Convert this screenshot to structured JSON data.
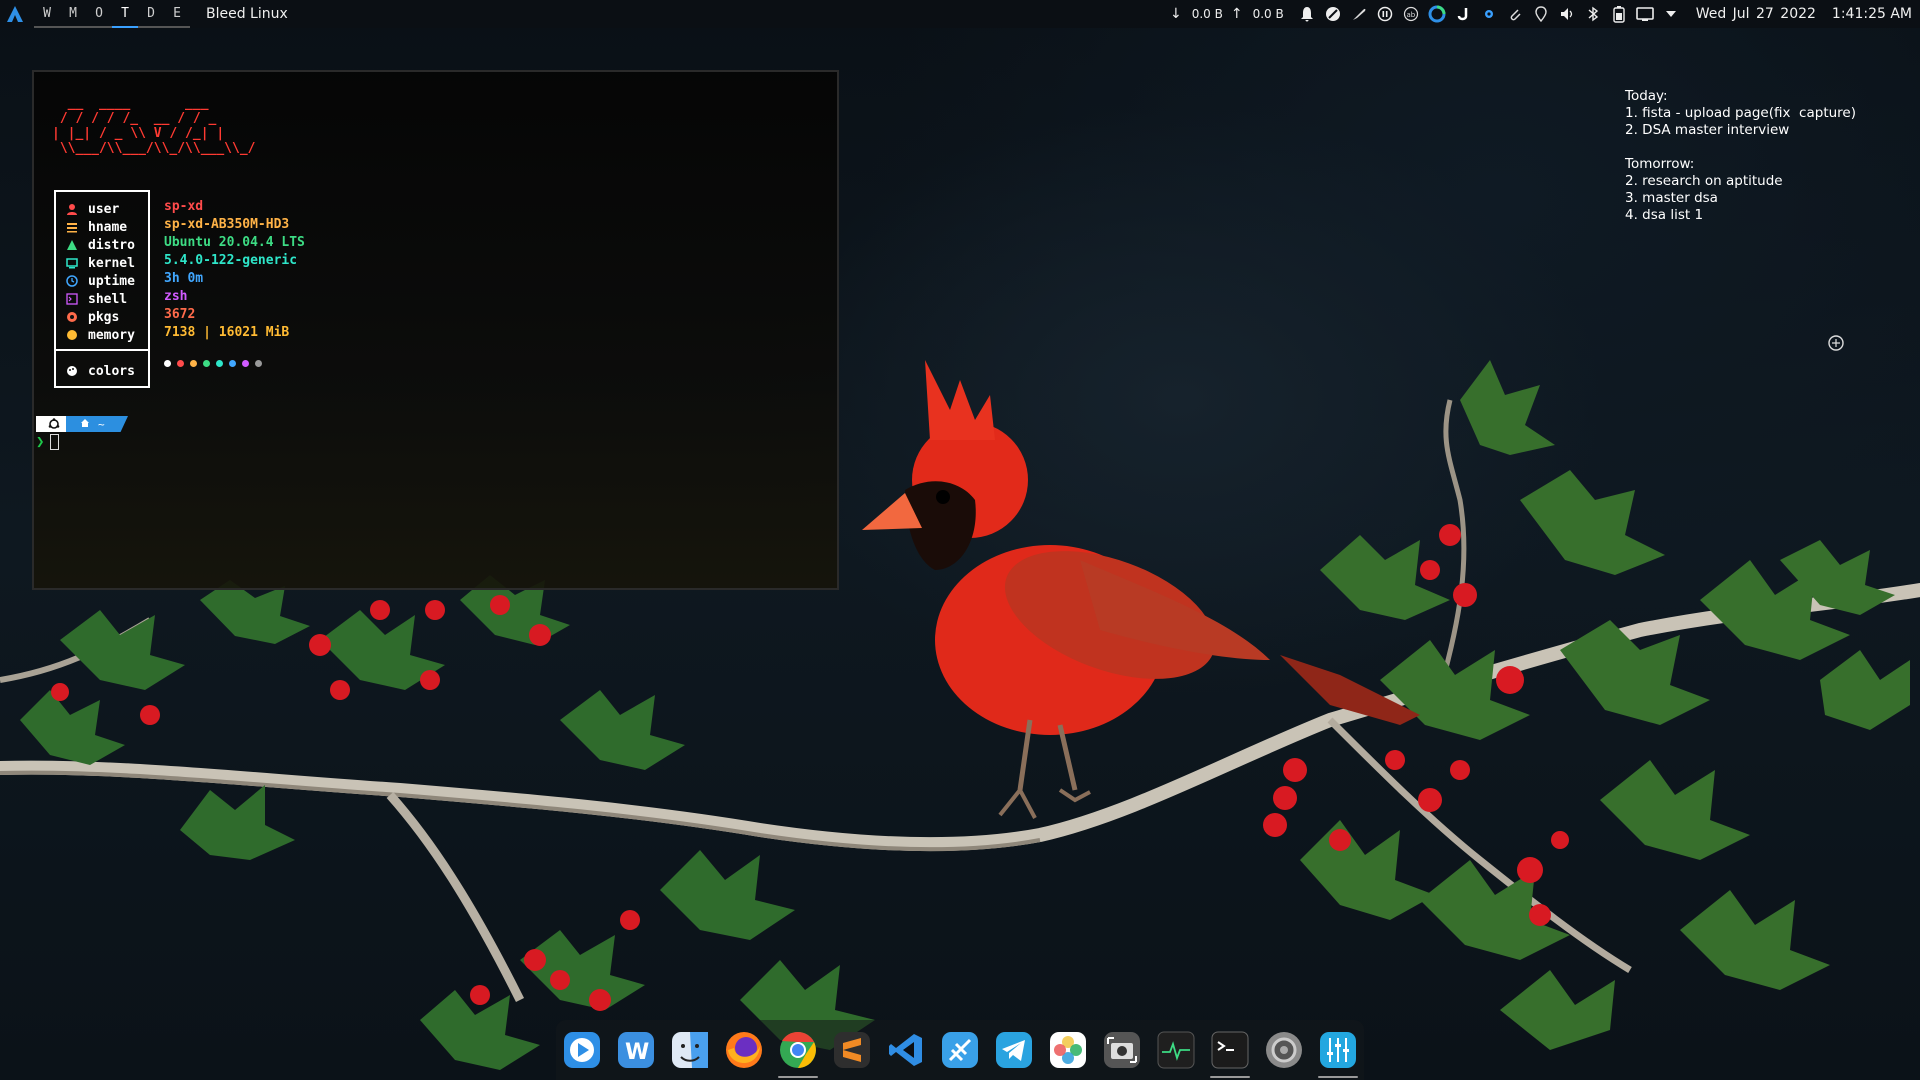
{
  "topbar": {
    "logo_icon": "arch-a-logo-icon",
    "workspaces": [
      {
        "label": "W",
        "active": false
      },
      {
        "label": "M",
        "active": false
      },
      {
        "label": "O",
        "active": false
      },
      {
        "label": "T",
        "active": true
      },
      {
        "label": "D",
        "active": false
      },
      {
        "label": "E",
        "active": false
      }
    ],
    "wm_name": "Bleed Linux",
    "net_down": "0.0 B",
    "net_up": "0.0 B",
    "tray_icons": [
      "bell-icon",
      "no-entry-icon",
      "feather-icon",
      "pause-circle-icon",
      "ab-icon",
      "ring-icon",
      "hook-icon",
      "gear-icon",
      "paperclip-icon",
      "location-pin-icon",
      "volume-icon",
      "bluetooth-icon",
      "battery-icon",
      "screen-icon",
      "caret-down-icon"
    ],
    "date": "Wed Jul 27 2022",
    "time": "1:41:25 AM"
  },
  "terminal": {
    "ascii_art": "  __  ____       ___\n / / / / /_  __ / / _\n| |_| / _ \\\\ V / /_| |\n \\\\___/\\\\___/\\\\_/\\\\___\\\\_/",
    "fetch": {
      "rows": [
        {
          "key": "user",
          "value": "sp-xd",
          "icon": "user-icon",
          "color": "#ff4b4b"
        },
        {
          "key": "hname",
          "value": "sp-xd-AB350M-HD3",
          "icon": "hostname-icon",
          "color": "#ffb347"
        },
        {
          "key": "distro",
          "value": "Ubuntu 20.04.4 LTS",
          "icon": "distro-icon",
          "color": "#3ddc84"
        },
        {
          "key": "kernel",
          "value": "5.4.0-122-generic",
          "icon": "kernel-icon",
          "color": "#2ee6c9"
        },
        {
          "key": "uptime",
          "value": "3h 0m",
          "icon": "clock-icon",
          "color": "#41a7ff"
        },
        {
          "key": "shell",
          "value": "zsh",
          "icon": "shell-icon",
          "color": "#d15bff"
        },
        {
          "key": "pkgs",
          "value": "3672",
          "icon": "package-icon",
          "color": "#ff6b4b"
        },
        {
          "key": "memory",
          "value": "7138 | 16021 MiB",
          "icon": "memory-icon",
          "color": "#ffbb33"
        }
      ],
      "colors_label": "colors",
      "palette": [
        "#ffffff",
        "#ff4b4b",
        "#ffb347",
        "#3ddc84",
        "#2ee6c9",
        "#41a7ff",
        "#d15bff",
        "#9a9a9a"
      ]
    },
    "prompt": {
      "seg1_icon": "ubuntu-icon",
      "seg2_icon": "home-icon",
      "path": "~",
      "arrow": "❯"
    }
  },
  "todo": {
    "today_header": "Today:",
    "today_items": [
      "1. fista - upload page(fix  capture)",
      "2. DSA master interview"
    ],
    "tomorrow_header": "Tomorrow:",
    "tomorrow_items": [
      "2. research on aptitude",
      "3. master dsa",
      "4. dsa list 1"
    ]
  },
  "dock": {
    "apps": [
      {
        "name": "media-player-icon",
        "color": "#2e8fe6",
        "running": false
      },
      {
        "name": "writer-icon",
        "color": "#3b8fe0",
        "running": false
      },
      {
        "name": "finder-icon",
        "color": "#4aa0ee",
        "running": false
      },
      {
        "name": "firefox-icon",
        "color": "#ff7a1a",
        "running": false
      },
      {
        "name": "chrome-icon",
        "color": "#34a853",
        "running": true
      },
      {
        "name": "sublime-text-icon",
        "color": "#f08a24",
        "running": false
      },
      {
        "name": "vscode-icon",
        "color": "#2f8de4",
        "running": false
      },
      {
        "name": "feather-app-icon",
        "color": "#39a0e8",
        "running": false
      },
      {
        "name": "telegram-icon",
        "color": "#2aa3e0",
        "running": false
      },
      {
        "name": "photos-icon",
        "color": "#f2c94c",
        "running": false
      },
      {
        "name": "screenshot-icon",
        "color": "#6d6d6d",
        "running": false
      },
      {
        "name": "system-monitor-icon",
        "color": "#2d2d2d",
        "running": false
      },
      {
        "name": "terminal-icon",
        "color": "#222222",
        "running": true
      },
      {
        "name": "settings-icon",
        "color": "#8a8a8a",
        "running": false
      },
      {
        "name": "equalizer-icon",
        "color": "#23a7e0",
        "running": true
      }
    ]
  }
}
